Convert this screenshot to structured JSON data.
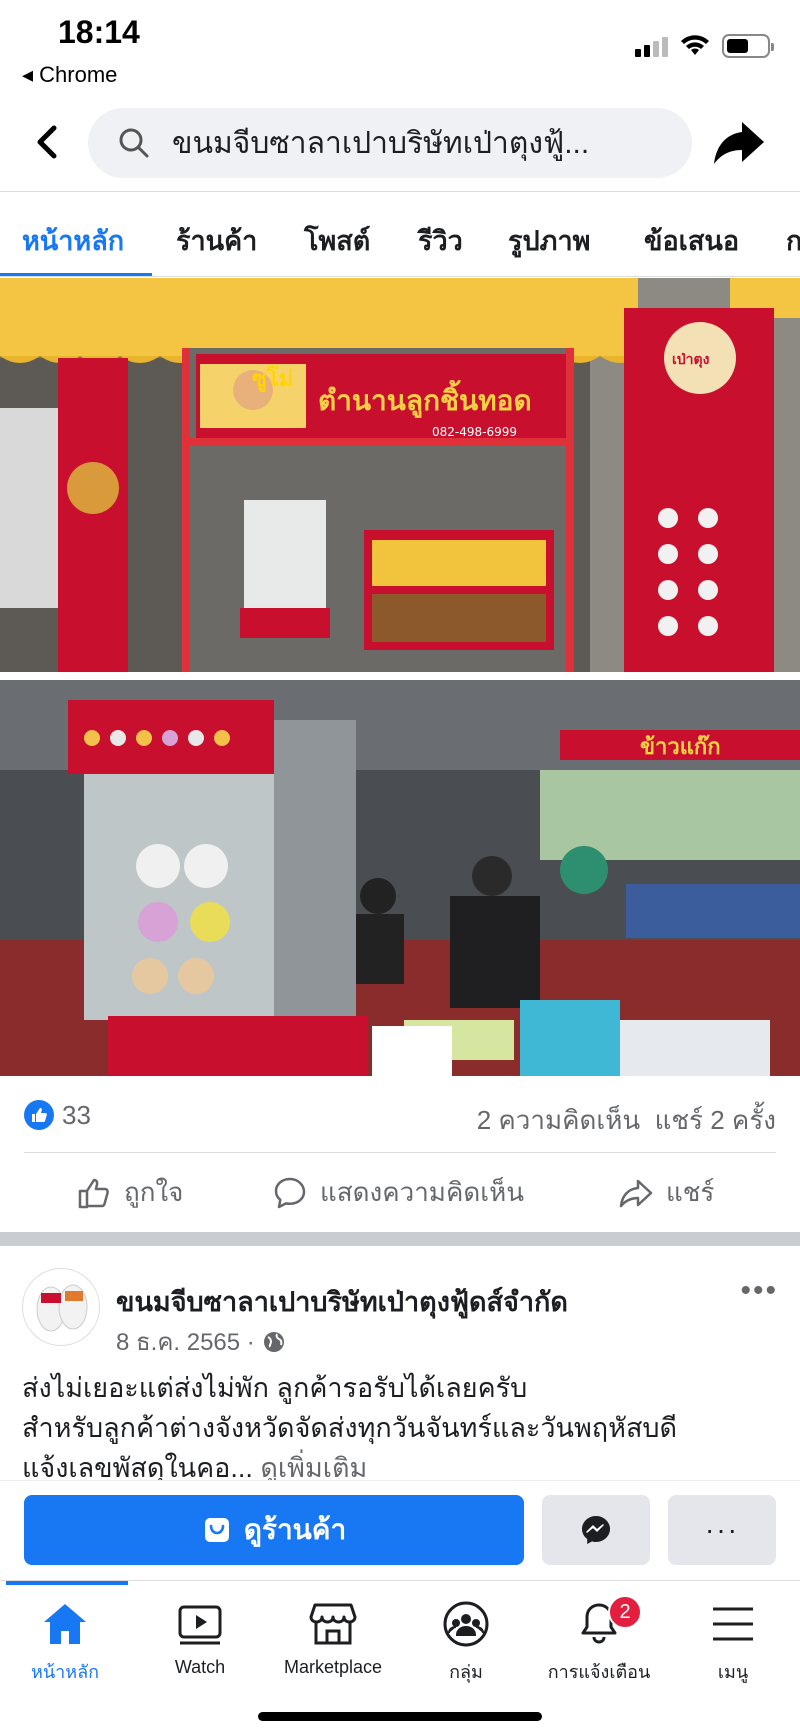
{
  "status_bar": {
    "time": "18:14",
    "back_app": "◂ Chrome"
  },
  "header": {
    "search_text": "ขนมจีบซาลาเปาบริษัทเป่าตุงฟู้...",
    "back_icon": "back-arrow-icon",
    "share_icon": "share-arrow-icon"
  },
  "tabs": [
    {
      "label": "หน้าหลัก",
      "active": true
    },
    {
      "label": "ร้านค้า"
    },
    {
      "label": "โพสต์"
    },
    {
      "label": "รีวิว"
    },
    {
      "label": "รูปภาพ"
    },
    {
      "label": "ข้อเสนอ"
    },
    {
      "label": "ก"
    }
  ],
  "photos": {
    "photo1_signs": {
      "brand": "ซูโม่",
      "shop": "ตำนานลูกชิ้นทอด",
      "phone": "082-498-6999",
      "banner": "เป่าตุง"
    },
    "photo2_signs": {
      "sign": "ข้าวแก๊ก"
    }
  },
  "reactions": {
    "like_count": "33",
    "comments_shares": "2 ความคิดเห็น  แชร์ 2 ครั้ง"
  },
  "actions": {
    "like": "ถูกใจ",
    "comment": "แสดงความคิดเห็น",
    "share": "แชร์"
  },
  "post": {
    "page_name": "ขนมจีบซาลาเปาบริษัทเป่าตุงฟู้ดส์จำกัด",
    "date": "8 ธ.ค. 2565 ·",
    "line1": "ส่งไม่เยอะแต่ส่งไม่พัก ลูกค้ารอรับได้เลยครับ",
    "line2": "สำหรับลูกค้าต่างจังหวัดจัดส่งทุกวันจันทร์และวันพฤหัสบดี",
    "line3": "แจ้งเลขพัสดุในคอ...",
    "see_more": "ดูเพิ่มเติม"
  },
  "cta": {
    "shop_label": "ดูร้านค้า",
    "more_label": "···"
  },
  "bottom_nav": [
    {
      "label": "หน้าหลัก",
      "icon": "home-icon",
      "active": true
    },
    {
      "label": "Watch",
      "icon": "watch-icon"
    },
    {
      "label": "Marketplace",
      "icon": "marketplace-icon"
    },
    {
      "label": "กลุ่ม",
      "icon": "groups-icon"
    },
    {
      "label": "การแจ้งเตือน",
      "icon": "bell-icon",
      "badge": "2"
    },
    {
      "label": "เมนู",
      "icon": "menu-icon"
    }
  ],
  "colors": {
    "accent": "#1877f2",
    "badge": "#e41e3f"
  }
}
